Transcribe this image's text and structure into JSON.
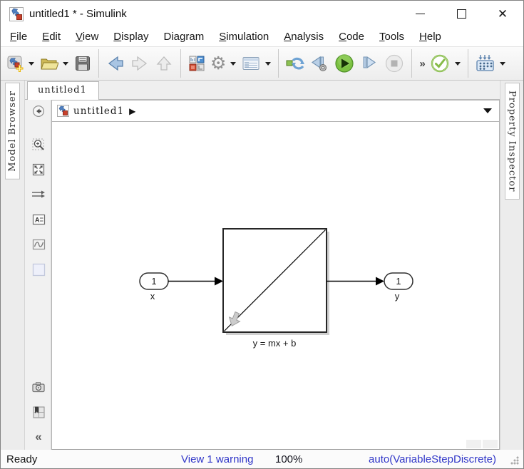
{
  "titlebar": {
    "title": "untitled1 * - Simulink",
    "close_glyph": "✕"
  },
  "menubar": {
    "items": [
      {
        "label": "File",
        "underline": 0
      },
      {
        "label": "Edit",
        "underline": 0
      },
      {
        "label": "View",
        "underline": 0
      },
      {
        "label": "Display",
        "underline": 0
      },
      {
        "label": "Diagram",
        "underline": 3
      },
      {
        "label": "Simulation",
        "underline": 0
      },
      {
        "label": "Analysis",
        "underline": 0
      },
      {
        "label": "Code",
        "underline": 0
      },
      {
        "label": "Tools",
        "underline": 0
      },
      {
        "label": "Help",
        "underline": 0
      }
    ]
  },
  "toolbar": {
    "overflow": "»"
  },
  "tabbar": {
    "active_tab": "untitled1"
  },
  "sidebars": {
    "left_label": "Model Browser",
    "right_label": "Property Inspector"
  },
  "breadcrumb": {
    "model": "untitled1",
    "arrow": "▶"
  },
  "palette": {
    "collapse_glyph": "«",
    "gear_note": ""
  },
  "diagram": {
    "inport": {
      "number": "1",
      "name": "x"
    },
    "block": {
      "label": "y = mx + b"
    },
    "outport": {
      "number": "1",
      "name": "y"
    }
  },
  "statusbar": {
    "status": "Ready",
    "warning_link": "View 1 warning",
    "zoom_level": "100%",
    "solver_link": "auto(VariableStepDiscrete)"
  },
  "colors": {
    "link_blue": "#3137c8",
    "run_green": "#67b52e",
    "accent_blue": "#5b82ad"
  }
}
